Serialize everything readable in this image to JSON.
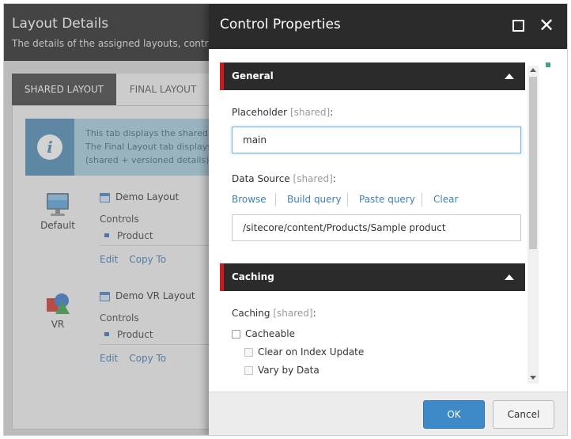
{
  "layout_details": {
    "title": "Layout Details",
    "subtitle": "The details of the assigned layouts, controls a",
    "tabs": [
      {
        "label": "SHARED LAYOUT",
        "active": true
      },
      {
        "label": "FINAL LAYOUT",
        "active": false
      }
    ],
    "info": {
      "line1": "This tab displays the shared lay",
      "line2": "The Final Layout tab displays th",
      "line3": "(shared + versioned details)."
    },
    "devices": [
      {
        "name": "Default",
        "icon": "monitor-icon",
        "layout": "Demo Layout",
        "controls_label": "Controls",
        "controls": [
          "Product"
        ],
        "links": [
          "Edit",
          "Copy To"
        ]
      },
      {
        "name": "VR",
        "icon": "vr-device-icon",
        "layout": "Demo VR Layout",
        "controls_label": "Controls",
        "controls": [
          "Product"
        ],
        "links": [
          "Edit",
          "Copy To"
        ]
      }
    ]
  },
  "control_properties": {
    "title": "Control Properties",
    "window_controls": {
      "maximize_icon": "maximize-icon",
      "close_icon": "close-icon",
      "close_glyph": "✕"
    },
    "sections": {
      "general": {
        "label": "General",
        "placeholder_label": "Placeholder",
        "placeholder_shared": "[shared]",
        "placeholder_colon": ":",
        "placeholder_value": "main",
        "datasource_label": "Data Source",
        "datasource_shared": "[shared]",
        "datasource_colon": ":",
        "datasource_links": [
          "Browse",
          "Build query",
          "Paste query",
          "Clear"
        ],
        "datasource_value": "/sitecore/content/Products/Sample product"
      },
      "caching": {
        "label": "Caching",
        "caching_label": "Caching",
        "caching_shared": "[shared]",
        "caching_colon": ":",
        "options": [
          {
            "label": "Cacheable",
            "checked": false,
            "enabled": true
          },
          {
            "label": "Clear on Index Update",
            "checked": false,
            "enabled": false
          },
          {
            "label": "Vary by Data",
            "checked": false,
            "enabled": false
          }
        ]
      }
    },
    "buttons": {
      "ok": "OK",
      "cancel": "Cancel"
    }
  },
  "colors": {
    "header_dark": "#2b2b2b",
    "section_accent": "#c41e1e",
    "link": "#3f7fb8",
    "primary_button": "#3e89c8",
    "info_background": "#a9cfe1"
  }
}
